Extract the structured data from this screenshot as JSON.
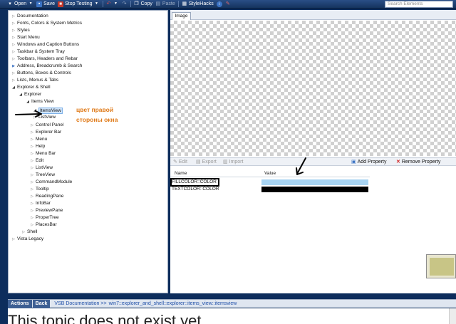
{
  "toolbar": {
    "open": "Open",
    "save": "Save",
    "stop_testing": "Stop Testing",
    "copy": "Copy",
    "paste": "Paste",
    "stylehacks": "StyleHacks",
    "search_placeholder": "Search Elements"
  },
  "tree": {
    "items": [
      "Documentation",
      "Fonts, Colors & System Metrics",
      "Styles",
      "Start Menu",
      "Windows and Caption Buttons",
      "Taskbar & System Tray",
      "Toolbars, Headers and Rebar",
      "Address, Breadcrumb & Search",
      "Buttons, Boxes & Controls",
      "Lists, Menus & Tabs",
      "Explorer & Shell",
      "Explorer",
      "Items View",
      "ItemsView",
      "ListView",
      "Control Panel",
      "Explorer Bar",
      "Menu",
      "Help",
      "Menu Bar",
      "Edit",
      "ListView",
      "TreeView",
      "CommandModule",
      "Tooltip",
      "ReadingPane",
      "InfoBar",
      "PreviewPane",
      "ProperTree",
      "PlacesBar",
      "Shell",
      "Vista Legacy"
    ]
  },
  "annotation": {
    "line1": "цвет правой",
    "line2": "стороны окна"
  },
  "image_tab": "Image",
  "props_toolbar": {
    "edit": "Edit",
    "export": "Export",
    "import": "Import",
    "add_property": "Add Property",
    "remove_property": "Remove Property"
  },
  "grid": {
    "col_name": "Name",
    "col_value": "Value",
    "rows": [
      {
        "name": "FILLCOLOR::COLOR",
        "color": "#a8d4f2"
      },
      {
        "name": "TEXTCOLOR::COLOR",
        "color": "#000000"
      }
    ]
  },
  "bottom": {
    "actions": "Actions",
    "back": "Back",
    "breadcrumb_prefix": "VSB Documentation >>",
    "breadcrumb_path": "win7::explorer_and_shell::explorer::items_view::itemsview",
    "content": "This topic does not exist yet"
  }
}
